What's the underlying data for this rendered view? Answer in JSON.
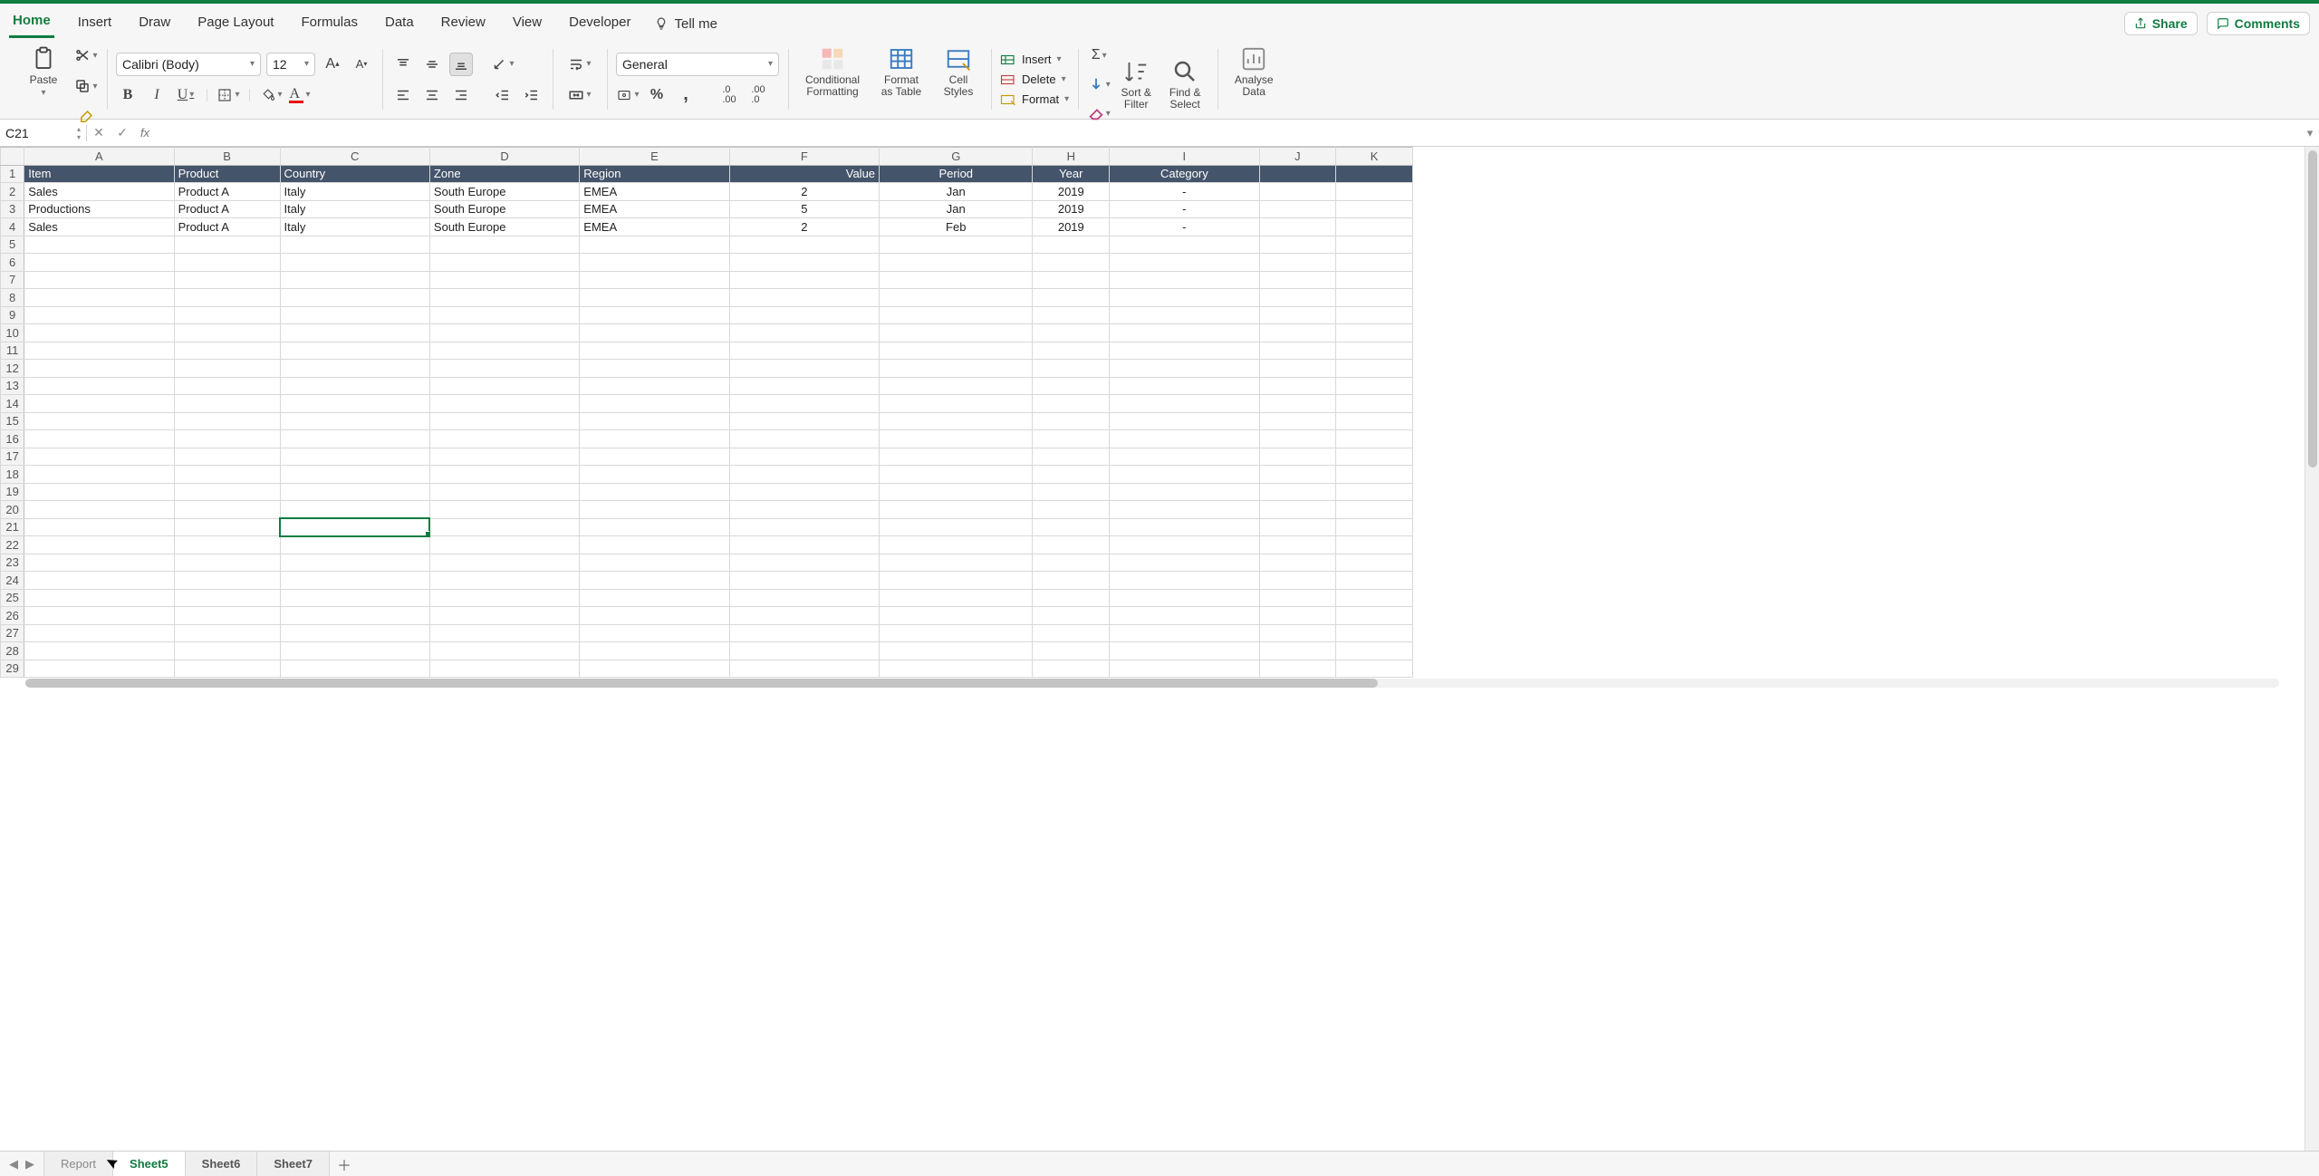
{
  "ribbon": {
    "tabs": [
      "Home",
      "Insert",
      "Draw",
      "Page Layout",
      "Formulas",
      "Data",
      "Review",
      "View",
      "Developer"
    ],
    "active_tab": "Home",
    "tell_me": "Tell me",
    "share": "Share",
    "comments": "Comments",
    "paste": "Paste",
    "font_name": "Calibri (Body)",
    "font_size": "12",
    "number_format": "General",
    "cond_fmt": "Conditional Formatting",
    "fmt_table": "Format as Table",
    "cell_styles": "Cell Styles",
    "insert": "Insert",
    "delete": "Delete",
    "format": "Format",
    "sort_filter": "Sort & Filter",
    "find_select": "Find & Select",
    "analyse": "Analyse Data"
  },
  "name_box": "C21",
  "formula_value": "",
  "columns": [
    "A",
    "B",
    "C",
    "D",
    "E",
    "F",
    "G",
    "H",
    "I",
    "J",
    "K"
  ],
  "col_widths": [
    "cA",
    "cB",
    "cC",
    "cD",
    "cE",
    "cF",
    "cG",
    "cH",
    "cI",
    "cJ",
    "cK"
  ],
  "headers": {
    "A": "Item",
    "B": "Product",
    "C": "Country",
    "D": "Zone",
    "E": "Region",
    "F": "Value",
    "G": "Period",
    "H": "Year",
    "I": "Category"
  },
  "header_align": {
    "F": "ar",
    "G": "ac",
    "H": "ac",
    "I": "ac"
  },
  "rows": [
    {
      "A": "Sales",
      "B": "Product A",
      "C": "Italy",
      "D": "South Europe",
      "E": "EMEA",
      "F": "2",
      "G": "Jan",
      "H": "2019",
      "I": "-"
    },
    {
      "A": "Productions",
      "B": "Product A",
      "C": "Italy",
      "D": "South Europe",
      "E": "EMEA",
      "F": "5",
      "G": "Jan",
      "H": "2019",
      "I": "-"
    },
    {
      "A": "Sales",
      "B": "Product A",
      "C": "Italy",
      "D": "South Europe",
      "E": "EMEA",
      "F": "2",
      "G": "Feb",
      "H": "2019",
      "I": "-"
    }
  ],
  "cell_align": {
    "F": "ac",
    "G": "ac",
    "H": "ac",
    "I": "ac"
  },
  "total_rows": 29,
  "selected_cell": {
    "col": "C",
    "row": 21
  },
  "sheet_tabs": [
    "Report",
    "Sheet5",
    "Sheet6",
    "Sheet7"
  ],
  "active_sheet": "Sheet5"
}
